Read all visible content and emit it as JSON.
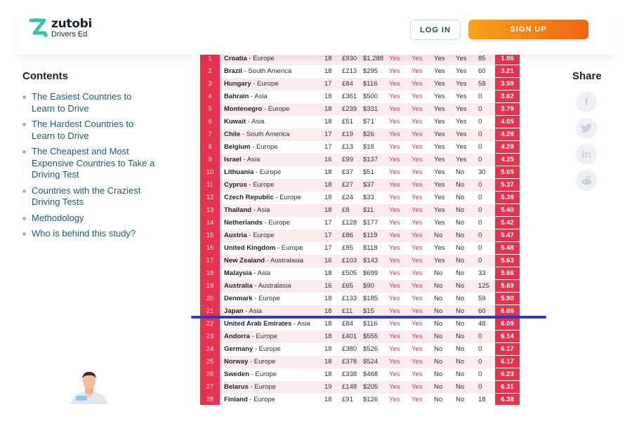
{
  "header": {
    "logo_name": "zutobi",
    "logo_sub": "Drivers Ed",
    "login_label": "LOG IN",
    "signup_label": "SIGN UP"
  },
  "contents": {
    "title": "Contents",
    "items": [
      "The Easiest Countries to Learn to Drive",
      "The Hardest Countries to Learn to Drive",
      "The Cheapest and Most Expensive Countries to Take a Driving Test",
      "Countries with the Craziest Driving Tests",
      "Methodology",
      "Who is behind this study?"
    ]
  },
  "share": {
    "title": "Share",
    "icons": [
      "facebook-icon",
      "twitter-icon",
      "linkedin-icon",
      "reddit-icon"
    ]
  },
  "table": {
    "rows": [
      {
        "rank": "1",
        "country": "Croatia",
        "region": "Europe",
        "age": "18",
        "gbp": "£930",
        "usd": "$1,288",
        "c1": "Yes",
        "c2": "Yes",
        "c3": "Yes",
        "c4": "Yes",
        "hours": "85",
        "score": "1.96"
      },
      {
        "rank": "2",
        "country": "Brazil",
        "region": "South America",
        "age": "18",
        "gbp": "£213",
        "usd": "$295",
        "c1": "Yes",
        "c2": "Yes",
        "c3": "Yes",
        "c4": "Yes",
        "hours": "60",
        "score": "3.21"
      },
      {
        "rank": "3",
        "country": "Hungary",
        "region": "Europe",
        "age": "17",
        "gbp": "£84",
        "usd": "$116",
        "c1": "Yes",
        "c2": "Yes",
        "c3": "Yes",
        "c4": "Yes",
        "hours": "58",
        "score": "3.59"
      },
      {
        "rank": "4",
        "country": "Bahrain",
        "region": "Asia",
        "age": "18",
        "gbp": "£361",
        "usd": "$500",
        "c1": "Yes",
        "c2": "Yes",
        "c3": "Yes",
        "c4": "Yes",
        "hours": "0",
        "score": "3.62"
      },
      {
        "rank": "5",
        "country": "Montenegro",
        "region": "Europe",
        "age": "18",
        "gbp": "£239",
        "usd": "$331",
        "c1": "Yes",
        "c2": "Yes",
        "c3": "Yes",
        "c4": "Yes",
        "hours": "0",
        "score": "3.79"
      },
      {
        "rank": "6",
        "country": "Kuwait",
        "region": "Asia",
        "age": "18",
        "gbp": "£51",
        "usd": "$71",
        "c1": "Yes",
        "c2": "Yes",
        "c3": "Yes",
        "c4": "Yes",
        "hours": "0",
        "score": "4.05"
      },
      {
        "rank": "7",
        "country": "Chile",
        "region": "South America",
        "age": "17",
        "gbp": "£19",
        "usd": "$26",
        "c1": "Yes",
        "c2": "Yes",
        "c3": "Yes",
        "c4": "Yes",
        "hours": "0",
        "score": "4.28"
      },
      {
        "rank": "8",
        "country": "Belgium",
        "region": "Europe",
        "age": "17",
        "gbp": "£13",
        "usd": "$18",
        "c1": "Yes",
        "c2": "Yes",
        "c3": "Yes",
        "c4": "Yes",
        "hours": "0",
        "score": "4.29"
      },
      {
        "rank": "9",
        "country": "Israel",
        "region": "Asia",
        "age": "16",
        "gbp": "£99",
        "usd": "$137",
        "c1": "Yes",
        "c2": "Yes",
        "c3": "Yes",
        "c4": "Yes",
        "hours": "0",
        "score": "4.35"
      },
      {
        "rank": "10",
        "country": "Lithuania",
        "region": "Europe",
        "age": "18",
        "gbp": "£37",
        "usd": "$51",
        "c1": "Yes",
        "c2": "Yes",
        "c3": "Yes",
        "c4": "No",
        "hours": "30",
        "score": "5.05"
      },
      {
        "rank": "11",
        "country": "Cyprus",
        "region": "Europe",
        "age": "18",
        "gbp": "£27",
        "usd": "$37",
        "c1": "Yes",
        "c2": "Yes",
        "c3": "Yes",
        "c4": "No",
        "hours": "0",
        "score": "5.37"
      },
      {
        "rank": "12",
        "country": "Czech Republic",
        "region": "Europe",
        "age": "18",
        "gbp": "£24",
        "usd": "$33",
        "c1": "Yes",
        "c2": "Yes",
        "c3": "Yes",
        "c4": "No",
        "hours": "0",
        "score": "5.38"
      },
      {
        "rank": "13",
        "country": "Thailand",
        "region": "Asia",
        "age": "18",
        "gbp": "£8",
        "usd": "$11",
        "c1": "Yes",
        "c2": "Yes",
        "c3": "Yes",
        "c4": "No",
        "hours": "0",
        "score": "5.40"
      },
      {
        "rank": "14",
        "country": "Netherlands",
        "region": "Europe",
        "age": "17",
        "gbp": "£128",
        "usd": "$177",
        "c1": "Yes",
        "c2": "Yes",
        "c3": "Yes",
        "c4": "No",
        "hours": "0",
        "score": "5.42"
      },
      {
        "rank": "15",
        "country": "Austria",
        "region": "Europe",
        "age": "17",
        "gbp": "£86",
        "usd": "$119",
        "c1": "Yes",
        "c2": "Yes",
        "c3": "No",
        "c4": "No",
        "hours": "0",
        "score": "5.47"
      },
      {
        "rank": "16",
        "country": "United Kingdom",
        "region": "Europe",
        "age": "17",
        "gbp": "£85",
        "usd": "$118",
        "c1": "Yes",
        "c2": "Yes",
        "c3": "Yes",
        "c4": "No",
        "hours": "0",
        "score": "5.48"
      },
      {
        "rank": "17",
        "country": "New Zealand",
        "region": "Australasia",
        "age": "16",
        "gbp": "£103",
        "usd": "$143",
        "c1": "Yes",
        "c2": "Yes",
        "c3": "Yes",
        "c4": "No",
        "hours": "0",
        "score": "5.63"
      },
      {
        "rank": "18",
        "country": "Malaysia",
        "region": "Asia",
        "age": "18",
        "gbp": "£505",
        "usd": "$699",
        "c1": "Yes",
        "c2": "Yes",
        "c3": "No",
        "c4": "No",
        "hours": "33",
        "score": "5.66"
      },
      {
        "rank": "19",
        "country": "Australia",
        "region": "Australasia",
        "age": "16",
        "gbp": "£65",
        "usd": "$90",
        "c1": "Yes",
        "c2": "Yes",
        "c3": "No",
        "c4": "No",
        "hours": "125",
        "score": "5.69"
      },
      {
        "rank": "20",
        "country": "Denmark",
        "region": "Europe",
        "age": "18",
        "gbp": "£133",
        "usd": "$185",
        "c1": "Yes",
        "c2": "Yes",
        "c3": "No",
        "c4": "No",
        "hours": "59",
        "score": "5.90"
      },
      {
        "rank": "21",
        "country": "Japan",
        "region": "Asia",
        "age": "18",
        "gbp": "£11",
        "usd": "$15",
        "c1": "Yes",
        "c2": "Yes",
        "c3": "No",
        "c4": "No",
        "hours": "60",
        "score": "6.06"
      },
      {
        "rank": "22",
        "country": "United Arab Emirates",
        "region": "Asia",
        "age": "18",
        "gbp": "£84",
        "usd": "$116",
        "c1": "Yes",
        "c2": "Yes",
        "c3": "No",
        "c4": "No",
        "hours": "48",
        "score": "6.09"
      },
      {
        "rank": "23",
        "country": "Andorra",
        "region": "Europe",
        "age": "18",
        "gbp": "£401",
        "usd": "$555",
        "c1": "Yes",
        "c2": "Yes",
        "c3": "No",
        "c4": "No",
        "hours": "0",
        "score": "6.14"
      },
      {
        "rank": "24",
        "country": "Germany",
        "region": "Europe",
        "age": "18",
        "gbp": "£380",
        "usd": "$526",
        "c1": "Yes",
        "c2": "Yes",
        "c3": "No",
        "c4": "No",
        "hours": "0",
        "score": "6.17"
      },
      {
        "rank": "25",
        "country": "Norway",
        "region": "Europe",
        "age": "18",
        "gbp": "£378",
        "usd": "$524",
        "c1": "Yes",
        "c2": "Yes",
        "c3": "No",
        "c4": "No",
        "hours": "0",
        "score": "6.17"
      },
      {
        "rank": "26",
        "country": "Sweden",
        "region": "Europe",
        "age": "18",
        "gbp": "£338",
        "usd": "$468",
        "c1": "Yes",
        "c2": "Yes",
        "c3": "No",
        "c4": "No",
        "hours": "0",
        "score": "6.23"
      },
      {
        "rank": "27",
        "country": "Belarus",
        "region": "Europe",
        "age": "19",
        "gbp": "£148",
        "usd": "$205",
        "c1": "Yes",
        "c2": "Yes",
        "c3": "No",
        "c4": "No",
        "hours": "0",
        "score": "6.31"
      },
      {
        "rank": "28",
        "country": "Finland",
        "region": "Europe",
        "age": "18",
        "gbp": "£91",
        "usd": "$126",
        "c1": "Yes",
        "c2": "Yes",
        "c3": "No",
        "c4": "No",
        "hours": "18",
        "score": "6.38"
      }
    ]
  },
  "colors": {
    "accent_red": "#e5334f",
    "highlight_line": "#2e3cb9",
    "signup_orange": "#f28a17"
  }
}
